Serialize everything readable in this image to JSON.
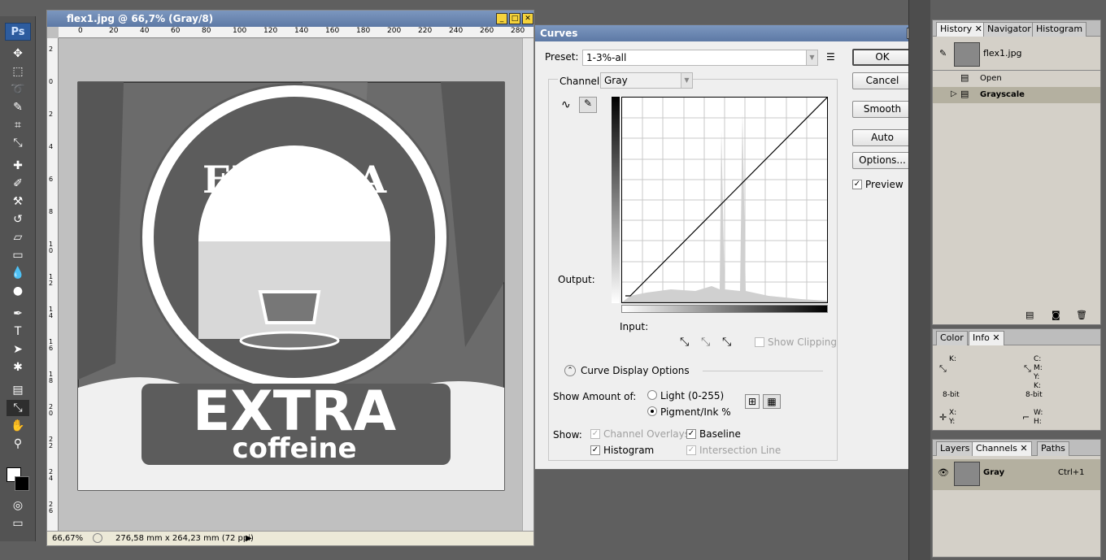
{
  "toolbar": {
    "logo": "Ps",
    "tools": [
      "move-tool",
      "marquee-tool",
      "lasso-tool",
      "quick-selection-tool",
      "crop-tool",
      "eyedropper-tool",
      "healing-brush-tool",
      "brush-tool",
      "clone-stamp-tool",
      "history-brush-tool",
      "eraser-tool",
      "gradient-tool",
      "blur-tool",
      "dodge-tool",
      "pen-tool",
      "type-tool",
      "path-selection-tool",
      "shape-tool",
      "notes-tool",
      "eyedropper-active-tool",
      "hand-tool",
      "zoom-tool"
    ]
  },
  "document": {
    "title": "flex1.jpg @ 66,7% (Gray/8)",
    "zoom": "66,67%",
    "doc_info": "276,58 mm x 264,23 mm (72 ppi)",
    "ruler_top": [
      "0",
      "20",
      "40",
      "60",
      "80",
      "100",
      "120",
      "140",
      "160",
      "180",
      "200",
      "220",
      "240",
      "260",
      "280"
    ],
    "ruler_left": [
      "2",
      "0",
      "2",
      "4",
      "6",
      "8",
      "10",
      "12",
      "14",
      "16",
      "18",
      "20",
      "22",
      "24",
      "26"
    ],
    "artwork": {
      "brand_top": "EL ALBA",
      "brand_main": "EXTRA",
      "brand_sub": "coffeine"
    }
  },
  "curves": {
    "title": "Curves",
    "preset_label": "Preset:",
    "preset_value": "1-3%-all",
    "channel_label": "Channel:",
    "channel_value": "Gray",
    "output_label": "Output:",
    "input_label": "Input:",
    "show_clipping": "Show Clipping",
    "display_options": "Curve Display Options",
    "show_amount_label": "Show Amount of:",
    "light_option": "Light",
    "light_range": "(0-255)",
    "pigment_option": "Pigment/Ink %",
    "show_label": "Show:",
    "channel_overlays": "Channel Overlays",
    "baseline": "Baseline",
    "histogram": "Histogram",
    "intersection_line": "Intersection Line",
    "buttons": {
      "ok": "OK",
      "cancel": "Cancel",
      "smooth": "Smooth",
      "auto": "Auto",
      "options": "Options..."
    },
    "preview": "Preview"
  },
  "history_panel": {
    "tabs": [
      "History",
      "Navigator",
      "Histogram"
    ],
    "snapshot": "flex1.jpg",
    "items": [
      "Open",
      "Grayscale"
    ]
  },
  "info_panel": {
    "tabs": [
      "Color",
      "Info"
    ],
    "k_label": "K:",
    "c_label": "C:",
    "m_label": "M:",
    "y_label": "Y:",
    "k2_label": "K:",
    "bit_left": "8-bit",
    "bit_right": "8-bit",
    "x_label": "X:",
    "y2_label": "Y:",
    "w_label": "W:",
    "h_label": "H:"
  },
  "channels_panel": {
    "tabs": [
      "Layers",
      "Channels",
      "Paths"
    ],
    "channel_name": "Gray",
    "shortcut": "Ctrl+1"
  }
}
